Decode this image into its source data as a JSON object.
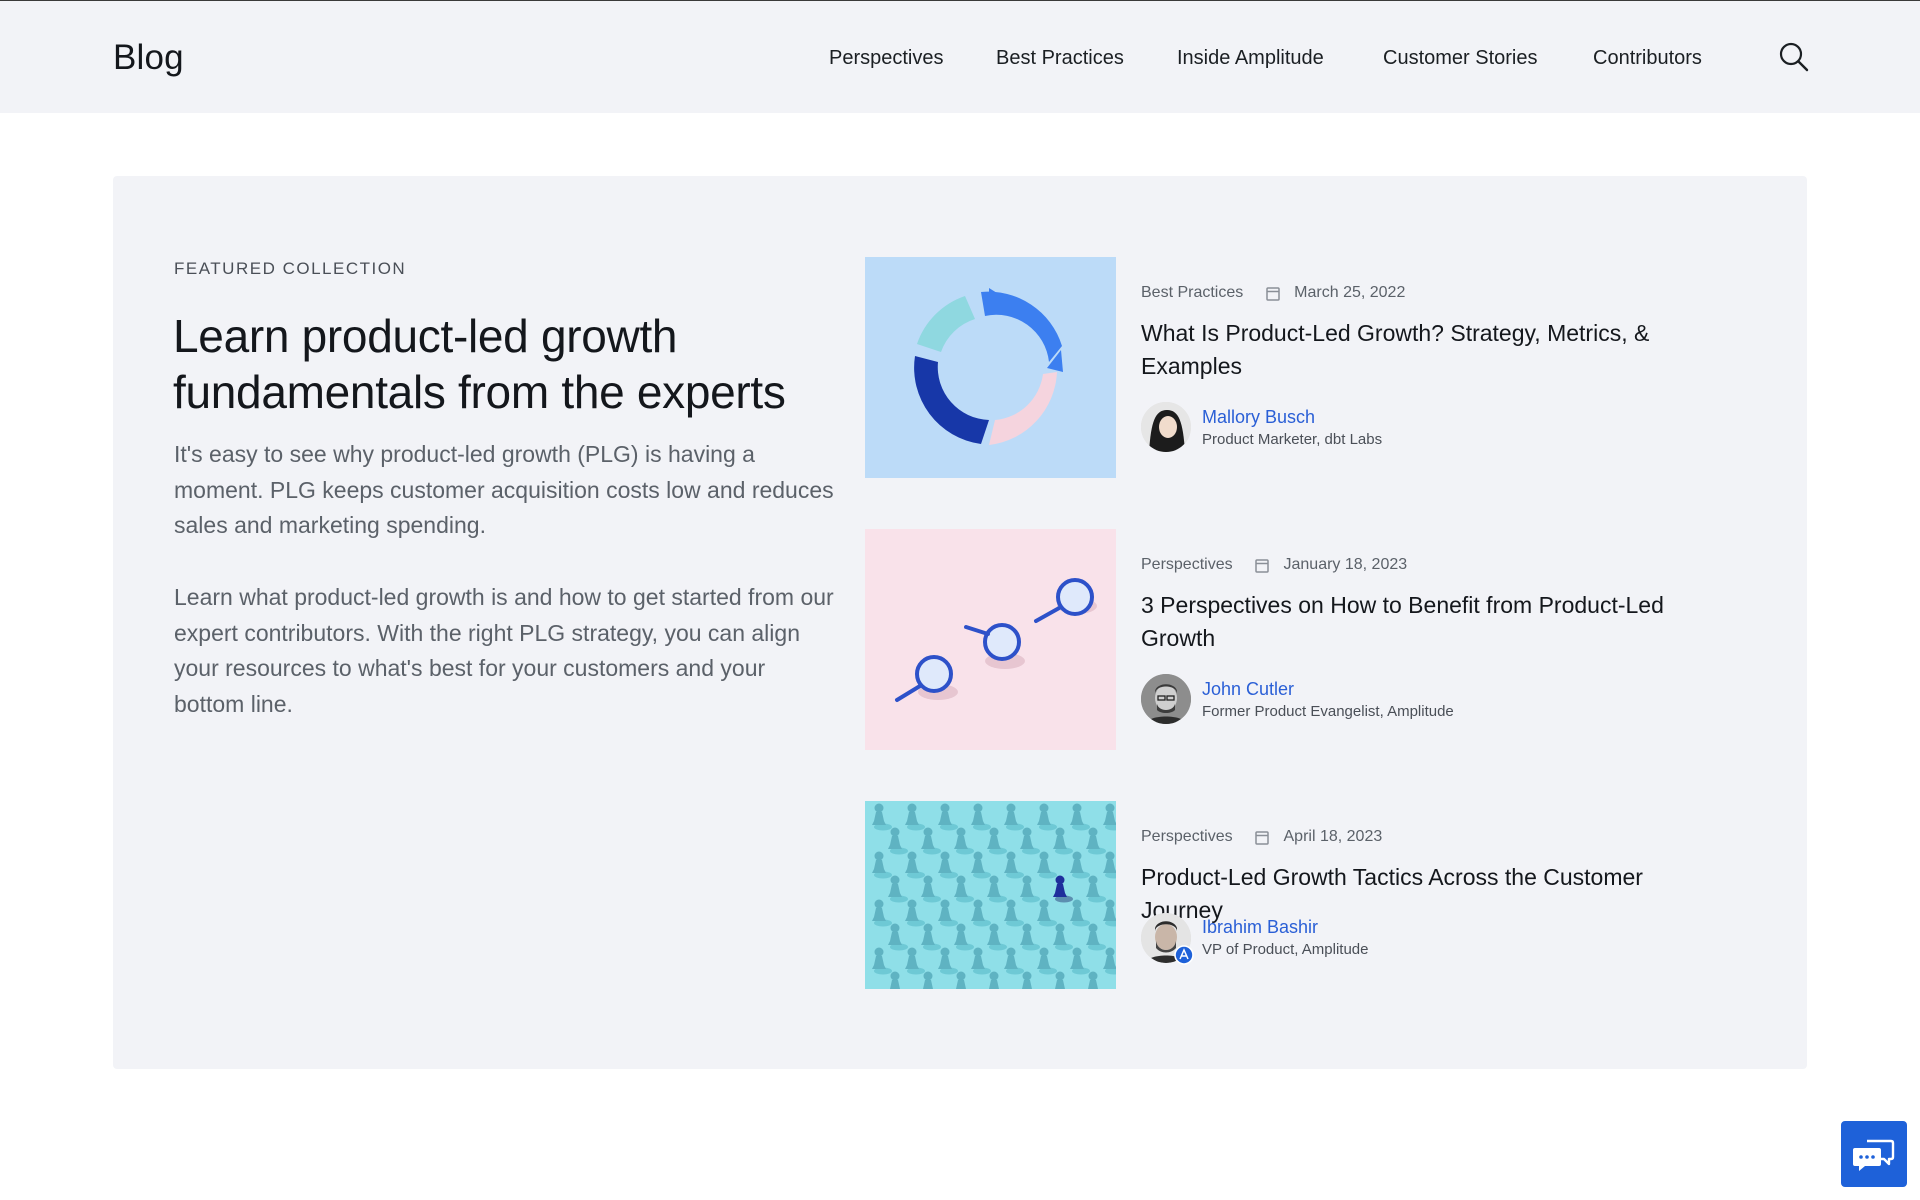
{
  "header": {
    "logo": "Blog",
    "nav": [
      "Perspectives",
      "Best Practices",
      "Inside Amplitude",
      "Customer Stories",
      "Contributors"
    ],
    "search_icon": "search-icon"
  },
  "featured": {
    "eyebrow": "FEATURED COLLECTION",
    "headline": "Learn product-led growth fundamentals from the experts",
    "paragraphs": [
      "It's easy to see why product-led growth (PLG) is having a moment. PLG keeps customer acquisition costs low and reduces sales and marketing spending.",
      "Learn what product-led growth is and how to get started from our expert contributors. With the right PLG strategy, you can align your resources to what's best for your customers and your bottom line."
    ]
  },
  "articles": [
    {
      "category": "Best Practices",
      "date": "March 25, 2022",
      "title": "What Is Product-Led Growth? Strategy, Metrics, & Examples",
      "author": "Mallory Busch",
      "role": "Product Marketer, dbt Labs",
      "image": "donut-cycle-image"
    },
    {
      "category": "Perspectives",
      "date": "January 18, 2023",
      "title": "3 Perspectives on How to Benefit from Product-Led Growth",
      "author": "John Cutler",
      "role": "Former Product Evangelist, Amplitude",
      "image": "magnifying-glasses-image"
    },
    {
      "category": "Perspectives",
      "date": "April 18, 2023",
      "title": "Product-Led Growth Tactics Across the Customer Journey",
      "author": "Ibrahim Bashir",
      "role": "VP of Product, Amplitude",
      "image": "chess-pawns-image"
    }
  ],
  "colors": {
    "accent": "#1e61d9",
    "link": "#2a5fd6",
    "card_bg": "#f2f3f7"
  },
  "chat": {
    "icon": "chat-icon"
  }
}
